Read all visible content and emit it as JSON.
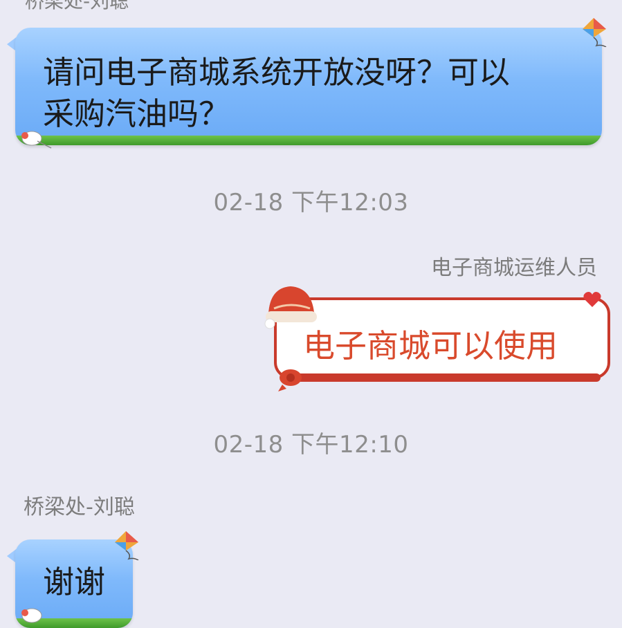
{
  "chat": {
    "top_name_partial": "桥梁处-刘聪",
    "messages": [
      {
        "sender": "",
        "text": "请问电子商城系统开放没呀？可以采购汽油吗？",
        "text_line1": "请问电子商城系统开放没呀？可以",
        "text_line2": "采购汽油吗？",
        "side": "left"
      },
      {
        "timestamp": "02-18 下午12:03"
      },
      {
        "sender": "电子商城运维人员",
        "text": "电子商城可以使用",
        "side": "right"
      },
      {
        "timestamp": "02-18 下午12:10"
      },
      {
        "sender": "桥梁处-刘聪",
        "text": "谢谢",
        "side": "left"
      }
    ]
  },
  "colors": {
    "background": "#eaeaf4",
    "blue_bubble": "#7fb9fb",
    "grass": "#4fae34",
    "red_accent": "#c93a2c",
    "red_text": "#d94a2c"
  },
  "icons": {
    "kite": "kite-icon",
    "hat": "santa-hat-icon",
    "heart": "heart-icon"
  }
}
